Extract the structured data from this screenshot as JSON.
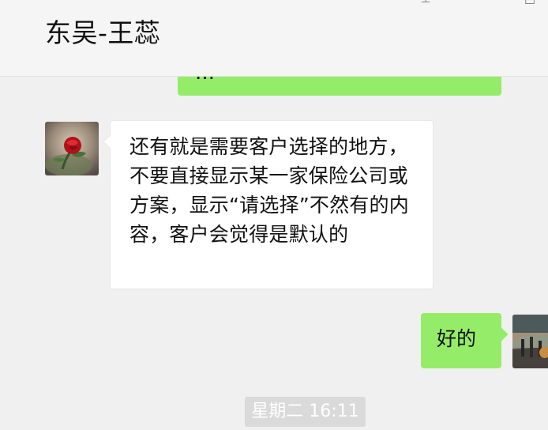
{
  "header": {
    "title": "东吴-王蕊",
    "controls": {
      "pin_icon": "pin-icon",
      "pin_glyph": "⊥",
      "minimize_icon": "minimize-icon",
      "minimize_glyph": "—",
      "maximize_icon": "maximize-icon",
      "maximize_glyph": "□"
    }
  },
  "chat": {
    "messages": [
      {
        "id": "previous-outgoing",
        "direction": "outgoing",
        "text": "…",
        "bubble_color": "#95ec69",
        "partial": true
      },
      {
        "id": "incoming-1",
        "direction": "incoming",
        "avatar": "rose-avatar",
        "text": "还有就是需要客户选择的地方，不要直接显示某一家保险公司或方案，显示“请选择”不然有的内容，客户会觉得是默认的",
        "bubble_color": "#ffffff"
      },
      {
        "id": "outgoing-1",
        "direction": "outgoing",
        "avatar": "outdoor-avatar",
        "text": "好的",
        "bubble_color": "#95ec69"
      }
    ],
    "timestamp": "星期二 16:11"
  },
  "colors": {
    "background": "#f0f0f0",
    "header_background": "#f5f5f5",
    "outgoing_bubble": "#95ec69",
    "incoming_bubble": "#ffffff",
    "timestamp_background": "#dadada"
  }
}
